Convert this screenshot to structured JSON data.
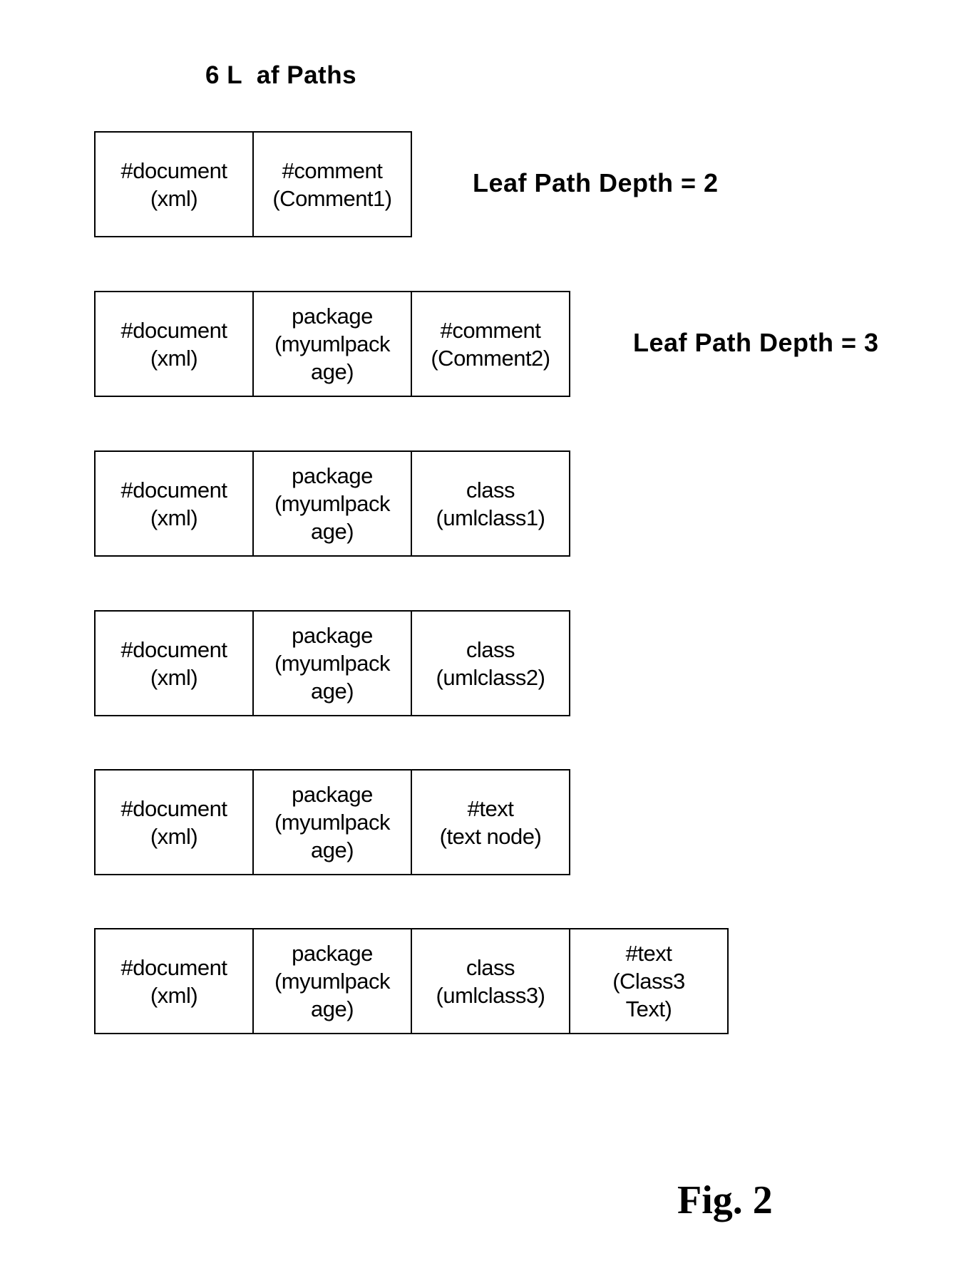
{
  "title": "6 L  af Paths",
  "leaf_paths": [
    {
      "nodes": [
        {
          "name": "#document",
          "value": "(xml)"
        },
        {
          "name": "#comment",
          "value": "(Comment1)"
        }
      ],
      "depth_label": "Leaf Path Depth = 2"
    },
    {
      "nodes": [
        {
          "name": "#document",
          "value": "(xml)"
        },
        {
          "name": "package",
          "value": "(myumlpack\nage)"
        },
        {
          "name": "#comment",
          "value": "(Comment2)"
        }
      ],
      "depth_label": "Leaf Path Depth = 3"
    },
    {
      "nodes": [
        {
          "name": "#document",
          "value": "(xml)"
        },
        {
          "name": "package",
          "value": "(myumlpack\nage)"
        },
        {
          "name": "class",
          "value": "(umlclass1)"
        }
      ]
    },
    {
      "nodes": [
        {
          "name": "#document",
          "value": "(xml)"
        },
        {
          "name": "package",
          "value": "(myumlpack\nage)"
        },
        {
          "name": "class",
          "value": "(umlclass2)"
        }
      ]
    },
    {
      "nodes": [
        {
          "name": "#document",
          "value": "(xml)"
        },
        {
          "name": "package",
          "value": "(myumlpack\nage)"
        },
        {
          "name": "#text",
          "value": "(text node)"
        }
      ]
    },
    {
      "nodes": [
        {
          "name": "#document",
          "value": "(xml)"
        },
        {
          "name": "package",
          "value": "(myumlpack\nage)"
        },
        {
          "name": "class",
          "value": "(umlclass3)"
        },
        {
          "name": "#text",
          "value": "(Class3\nText)"
        }
      ]
    }
  ],
  "figure_label": "Fig. 2"
}
